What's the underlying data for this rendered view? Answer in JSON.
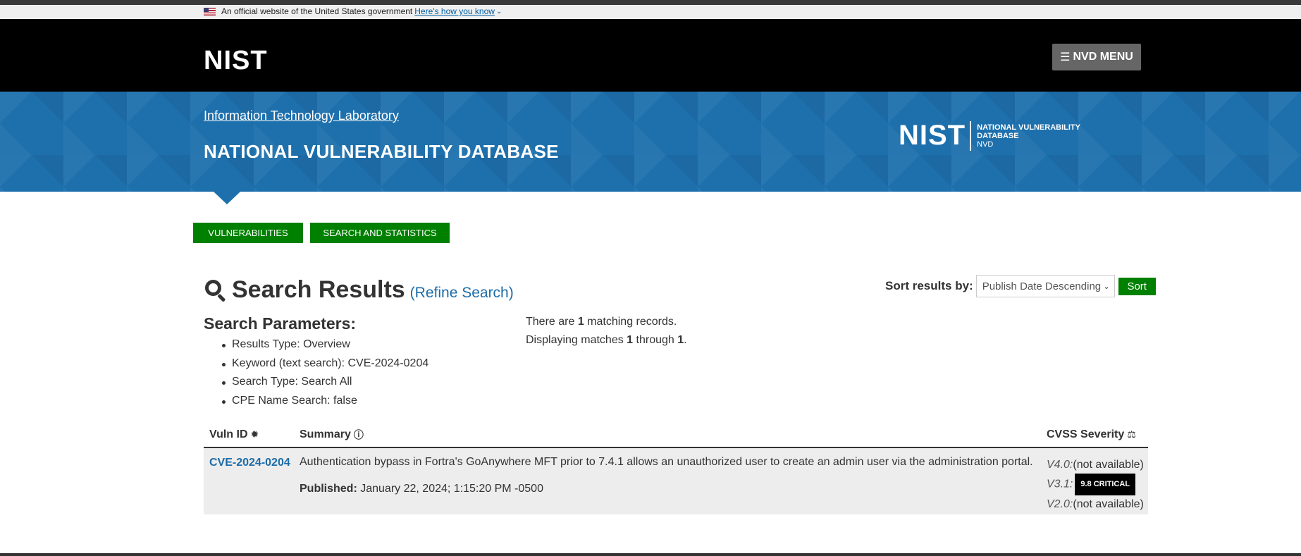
{
  "gov_banner": {
    "text": "An official website of the United States government",
    "link": "Here's how you know"
  },
  "header": {
    "logo": "NIST",
    "menu_label": "NVD MENU"
  },
  "banner": {
    "itl_link": "Information Technology Laboratory",
    "title": "NATIONAL VULNERABILITY DATABASE",
    "logo_big": "NIST",
    "logo_line1": "NATIONAL VULNERABILITY",
    "logo_line2": "DATABASE",
    "logo_line3": "NVD"
  },
  "nav": {
    "vulnerabilities": "VULNERABILITIES",
    "search_stats": "SEARCH AND STATISTICS"
  },
  "results": {
    "title": "Search Results",
    "refine": "(Refine Search)"
  },
  "sort": {
    "label": "Sort results by:",
    "selected": "Publish Date Descending",
    "button": "Sort"
  },
  "params": {
    "title": "Search Parameters:",
    "items": [
      "Results Type: Overview",
      "Keyword (text search): CVE-2024-0204",
      "Search Type: Search All",
      "CPE Name Search: false"
    ]
  },
  "matches": {
    "line1_pre": "There are ",
    "count": "1",
    "line1_post": " matching records.",
    "line2_pre": "Displaying matches ",
    "from": "1",
    "through": " through ",
    "to": "1",
    "end": "."
  },
  "table": {
    "headers": {
      "id": "Vuln ID",
      "summary": "Summary",
      "cvss": "CVSS Severity"
    },
    "rows": [
      {
        "id": "CVE-2024-0204",
        "summary": "Authentication bypass in Fortra's GoAnywhere MFT prior to 7.4.1 allows an unauthorized user to create an admin user via the administration portal.",
        "published_label": "Published:",
        "published": "January 22, 2024; 1:15:20 PM -0500",
        "v4_label": "V4.0:",
        "v4": "(not available)",
        "v31_label": "V3.1:",
        "v31": "9.8 CRITICAL",
        "v2_label": "V2.0:",
        "v2": "(not available)"
      }
    ]
  },
  "colors": {
    "green": "#008000",
    "banner_blue": "#1e70ad",
    "link_blue": "#1c6ca8",
    "critical_badge": "#000000"
  }
}
